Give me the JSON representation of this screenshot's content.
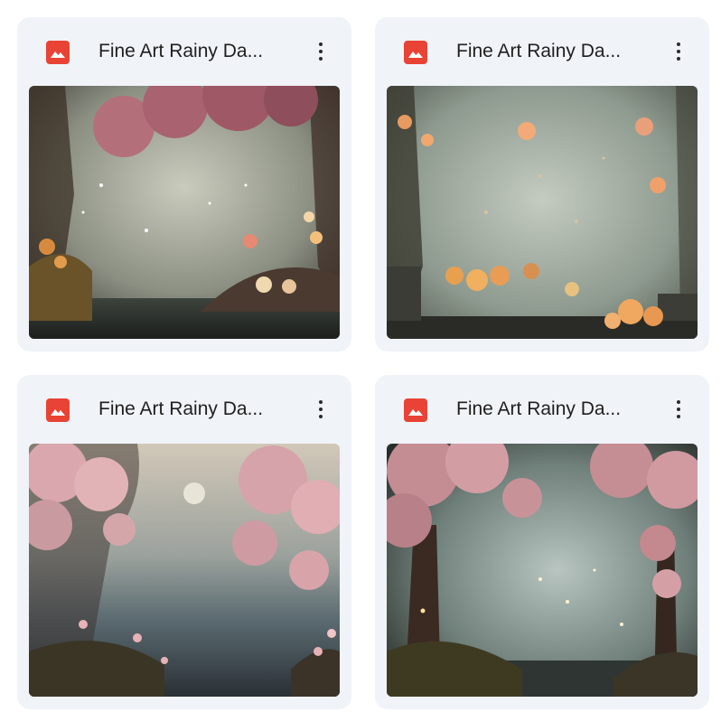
{
  "files": [
    {
      "title": "Fine Art Rainy Da...",
      "icon": "image-file-icon",
      "menu_icon": "more-vert-icon",
      "thumbnail": "misty lake with pink hydrangea pom-pom flowers"
    },
    {
      "title": "Fine Art Rainy Da...",
      "icon": "image-file-icon",
      "menu_icon": "more-vert-icon",
      "thumbnail": "misty garden with orange roses and falling petals"
    },
    {
      "title": "Fine Art Rainy Da...",
      "icon": "image-file-icon",
      "menu_icon": "more-vert-icon",
      "thumbnail": "pink blossom trees framing a foggy lake with moon"
    },
    {
      "title": "Fine Art Rainy Da...",
      "icon": "image-file-icon",
      "menu_icon": "more-vert-icon",
      "thumbnail": "pink cherry blossom trees over a sparkling lake"
    }
  ],
  "colors": {
    "card_background": "#f0f3f8",
    "icon_red": "#e84335",
    "title_text": "#1f1f1f"
  }
}
